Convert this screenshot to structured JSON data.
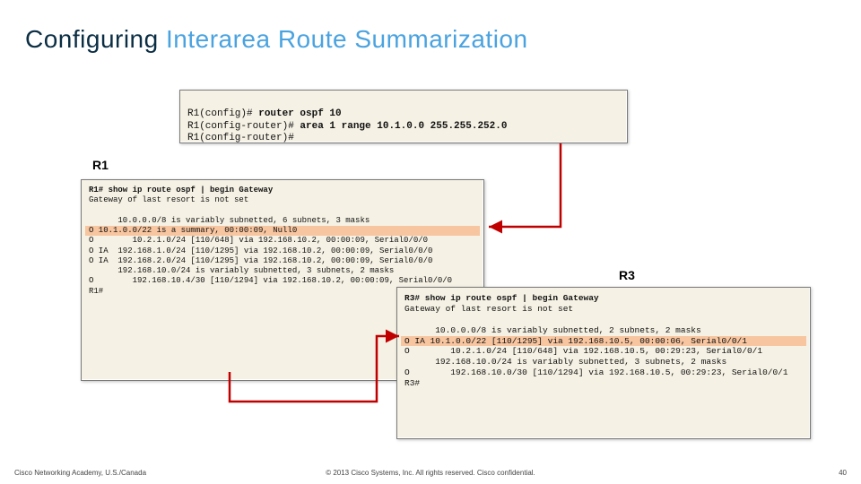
{
  "title": {
    "part1": "Configuring",
    "part2": "Interarea Route Summarization"
  },
  "labels": {
    "r1": "R1",
    "r3": "R3"
  },
  "box1": {
    "p1": "R1(config)# ",
    "b1": "router ospf 10",
    "p2": "R1(config-router)# ",
    "b2": "area 1 range 10.1.0.0 255.255.252.0",
    "p3": "R1(config-router)#"
  },
  "box2": {
    "l1": "R1# show ip route ospf | begin Gateway",
    "l2": "Gateway of last resort is not set",
    "l4": "      10.0.0.0/8 is variably subnetted, 6 subnets, 3 masks",
    "hl": "O        10.1.0.0/22 is a summary, 00:00:09, Null0",
    "l6": "O        10.2.1.0/24 [110/648] via 192.168.10.2, 00:00:09, Serial0/0/0",
    "l8": "O IA  192.168.1.0/24 [110/1295] via 192.168.10.2, 00:00:09, Serial0/0/0",
    "l10": "O IA  192.168.2.0/24 [110/1295] via 192.168.10.2, 00:00:09, Serial0/0/0",
    "l12": "      192.168.10.0/24 is variably subnetted, 3 subnets, 2 masks",
    "l14": "O        192.168.10.4/30 [110/1294] via 192.168.10.2, 00:00:09, Serial0/0/0",
    "l16": "R1#"
  },
  "box3": {
    "l1": "R3# show ip route ospf | begin Gateway",
    "l2": "Gateway of last resort is not set",
    "l4": "      10.0.0.0/8 is variably subnetted, 2 subnets, 2 masks",
    "hl": "O IA     10.1.0.0/22 [110/1295] via 192.168.10.5, 00:00:06, Serial0/0/1",
    "l7": "O        10.2.1.0/24 [110/648] via 192.168.10.5, 00:29:23, Serial0/0/1",
    "l9": "      192.168.10.0/24 is variably subnetted, 3 subnets, 2 masks",
    "l11": "O        192.168.10.0/30 [110/1294] via 192.168.10.5, 00:29:23, Serial0/0/1",
    "l13": "R3#"
  },
  "footer": {
    "left": "Cisco Networking Academy, U.S./Canada",
    "center": "© 2013 Cisco Systems, Inc. All rights reserved. Cisco confidential.",
    "right": "40"
  },
  "chart_data": {
    "type": "table",
    "title": "Configuring Interarea Route Summarization",
    "config_commands": {
      "router": "R1",
      "commands": [
        "router ospf 10",
        "area 1 range 10.1.0.0 255.255.252.0"
      ]
    },
    "r1_routes": [
      {
        "type": "O",
        "network": "10.1.0.0/22",
        "detail": "is a summary, 00:00:09, Null0",
        "highlighted": true
      },
      {
        "type": "O",
        "network": "10.2.1.0/24",
        "metric": "[110/648]",
        "via": "192.168.10.2",
        "age": "00:00:09",
        "iface": "Serial0/0/0"
      },
      {
        "type": "O IA",
        "network": "192.168.1.0/24",
        "metric": "[110/1295]",
        "via": "192.168.10.2",
        "age": "00:00:09",
        "iface": "Serial0/0/0"
      },
      {
        "type": "O IA",
        "network": "192.168.2.0/24",
        "metric": "[110/1295]",
        "via": "192.168.10.2",
        "age": "00:00:09",
        "iface": "Serial0/0/0"
      },
      {
        "type": "O",
        "network": "192.168.10.4/30",
        "metric": "[110/1294]",
        "via": "192.168.10.2",
        "age": "00:00:09",
        "iface": "Serial0/0/0"
      }
    ],
    "r3_routes": [
      {
        "type": "O IA",
        "network": "10.1.0.0/22",
        "metric": "[110/1295]",
        "via": "192.168.10.5",
        "age": "00:00:06",
        "iface": "Serial0/0/1",
        "highlighted": true
      },
      {
        "type": "O",
        "network": "10.2.1.0/24",
        "metric": "[110/648]",
        "via": "192.168.10.5",
        "age": "00:29:23",
        "iface": "Serial0/0/1"
      },
      {
        "type": "O",
        "network": "192.168.10.0/30",
        "metric": "[110/1294]",
        "via": "192.168.10.5",
        "age": "00:29:23",
        "iface": "Serial0/0/1"
      }
    ]
  }
}
